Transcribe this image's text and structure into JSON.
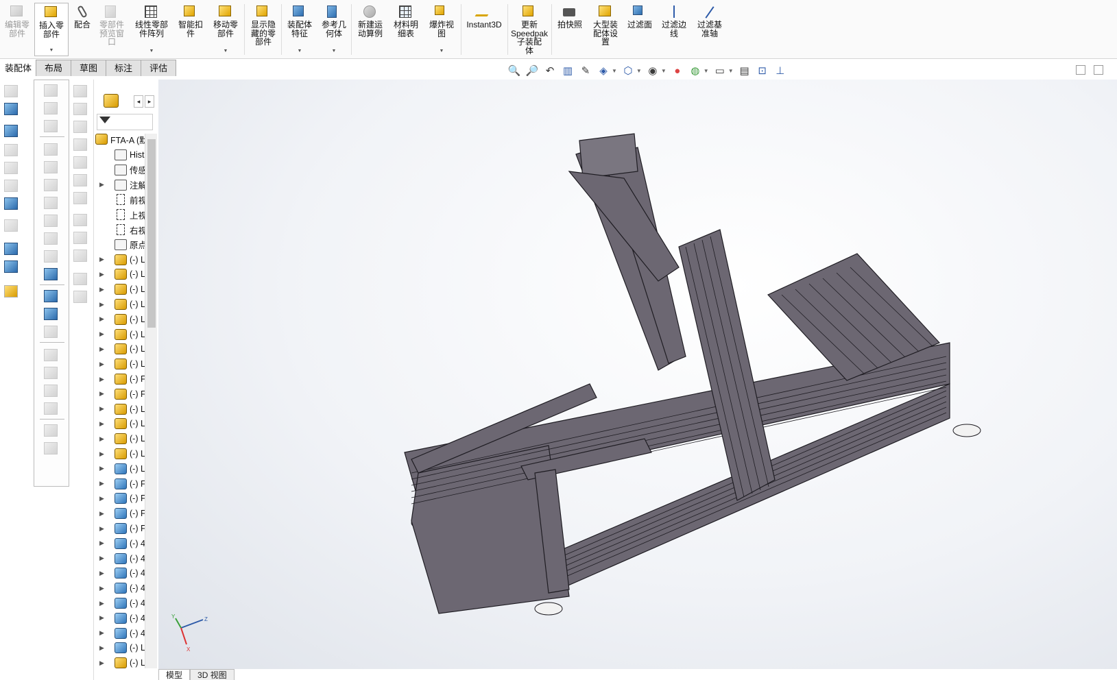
{
  "ribbon": {
    "buttons": [
      {
        "label": "编辑零\n部件",
        "icon": "edit-component-icon",
        "disabled": true
      },
      {
        "label": "插入零\n部件",
        "icon": "insert-components-icon",
        "disabled": false,
        "selected": true
      },
      {
        "label": "配合",
        "icon": "mate-icon",
        "disabled": false
      },
      {
        "label": "零部件\n预览窗\n口",
        "icon": "component-preview-icon",
        "disabled": true
      },
      {
        "label": "线性零部\n件阵列",
        "icon": "linear-pattern-icon",
        "disabled": false
      },
      {
        "label": "智能扣\n件",
        "icon": "smart-fasteners-icon",
        "disabled": false
      },
      {
        "label": "移动零\n部件",
        "icon": "move-component-icon",
        "disabled": false
      },
      {
        "label": "显示隐\n藏的零\n部件",
        "icon": "show-hidden-components-icon",
        "disabled": false
      },
      {
        "label": "装配体\n特征",
        "icon": "assembly-features-icon",
        "disabled": false
      },
      {
        "label": "参考几\n何体",
        "icon": "reference-geometry-icon",
        "disabled": false
      },
      {
        "label": "新建运\n动算例",
        "icon": "new-motion-study-icon",
        "disabled": false
      },
      {
        "label": "材料明\n细表",
        "icon": "bill-of-materials-icon",
        "disabled": false
      },
      {
        "label": "爆炸视\n图",
        "icon": "exploded-view-icon",
        "disabled": false
      },
      {
        "label": "Instant3D",
        "icon": "instant3d-icon",
        "disabled": false
      },
      {
        "label": "更新\nSpeedpak\n子装配\n体",
        "icon": "speedpak-icon",
        "disabled": false
      },
      {
        "label": "拍快照",
        "icon": "snapshot-icon",
        "disabled": false
      },
      {
        "label": "大型装\n配体设\n置",
        "icon": "large-assembly-icon",
        "disabled": false
      },
      {
        "label": "过滤面",
        "icon": "filter-faces-icon",
        "disabled": false
      },
      {
        "label": "过滤边\n线",
        "icon": "filter-edges-icon",
        "disabled": false
      },
      {
        "label": "过滤基\n准轴",
        "icon": "filter-axes-icon",
        "disabled": false
      }
    ]
  },
  "tabs": [
    "装配体",
    "布局",
    "草图",
    "标注",
    "评估"
  ],
  "tree": {
    "root": "FTA-A (默",
    "items": [
      {
        "type": "folder",
        "label": "Histo"
      },
      {
        "type": "folder",
        "label": "传感"
      },
      {
        "type": "folder",
        "label": "注解",
        "expandable": true
      },
      {
        "type": "plane",
        "label": "前视"
      },
      {
        "type": "plane",
        "label": "上视"
      },
      {
        "type": "plane",
        "label": "右视"
      },
      {
        "type": "origin",
        "label": "原点"
      },
      {
        "type": "asm",
        "label": "(-) L"
      },
      {
        "type": "asm",
        "label": "(-) L"
      },
      {
        "type": "asm",
        "label": "(-) L"
      },
      {
        "type": "asm",
        "label": "(-) L"
      },
      {
        "type": "asm",
        "label": "(-) L"
      },
      {
        "type": "asm",
        "label": "(-) L"
      },
      {
        "type": "asm",
        "label": "(-) L"
      },
      {
        "type": "asm",
        "label": "(-) L"
      },
      {
        "type": "asm",
        "label": "(-) F"
      },
      {
        "type": "asm",
        "label": "(-) F"
      },
      {
        "type": "asm",
        "label": "(-) L"
      },
      {
        "type": "asm",
        "label": "(-) L"
      },
      {
        "type": "asm",
        "label": "(-) L"
      },
      {
        "type": "asm",
        "label": "(-) L"
      },
      {
        "type": "part",
        "label": "(-) L"
      },
      {
        "type": "part",
        "label": "(-) F"
      },
      {
        "type": "part",
        "label": "(-) F"
      },
      {
        "type": "part",
        "label": "(-) F"
      },
      {
        "type": "part",
        "label": "(-) F"
      },
      {
        "type": "part",
        "label": "(-) 4"
      },
      {
        "type": "part",
        "label": "(-) 4"
      },
      {
        "type": "part",
        "label": "(-) 4"
      },
      {
        "type": "part",
        "label": "(-) 4"
      },
      {
        "type": "part",
        "label": "(-) 4"
      },
      {
        "type": "part",
        "label": "(-) 4"
      },
      {
        "type": "part",
        "label": "(-) 4"
      },
      {
        "type": "part",
        "label": "(-) L"
      },
      {
        "type": "asm",
        "label": "(-) L"
      }
    ]
  },
  "bottom_tabs": [
    "模型",
    "3D 视图"
  ],
  "triad": {
    "x": "X",
    "y": "Y",
    "z": "Z"
  },
  "colors": {
    "frame": "#6c6772",
    "frame_edge": "#1e1c22",
    "accent": "#2d5aa8"
  }
}
